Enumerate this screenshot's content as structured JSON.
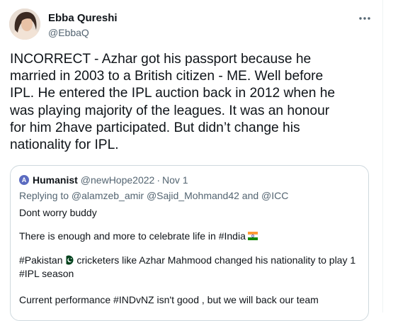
{
  "tweet": {
    "author_name": "Ebba Qureshi",
    "author_handle": "@EbbaQ",
    "more_icon": "more-icon",
    "lines": [
      "INCORRECT - Azhar got his passport because he",
      "married in 2003 to a British citizen - ME. Well before",
      "IPL. He entered the IPL auction back in 2012 when he",
      "was playing majority of the leagues. It was an honour",
      "for him 2have participated. But didn’t change his",
      "nationality for IPL."
    ]
  },
  "quoted_tweet": {
    "avatar_letter": "A",
    "author_name": "Humanist",
    "author_handle": "@newHope2022",
    "separator": "·",
    "date": "Nov 1",
    "reply_line": "Replying to @alamzeb_amir @Sajid_Mohmand42 and @ICC",
    "line_1": "Dont worry buddy",
    "line_2": "There is enough and more to celebrate life in #India",
    "line_3a": "#Pakistan",
    "line_3b": " cricketers like Azhar Mahmood changed his nationality to play 1",
    "line_4": "#IPL season",
    "line_5": "Current performance #INDvNZ isn't good , but we will back our team",
    "india_flag_icon": "india-flag-icon",
    "pakistan_flag_icon": "pakistan-flag-icon"
  }
}
